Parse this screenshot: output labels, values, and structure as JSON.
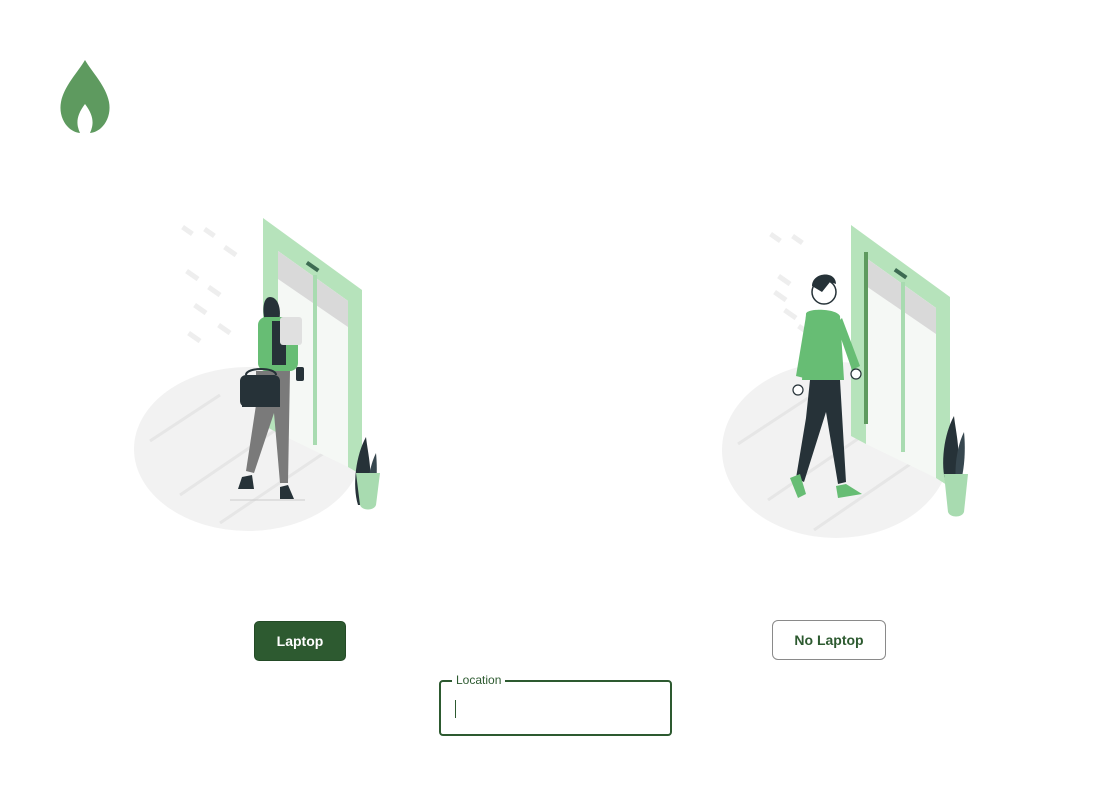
{
  "brand": {
    "logo_icon": "flame-icon",
    "accent_color": "#5e9a5f",
    "primary_dark": "#2d5a30"
  },
  "illustrations": {
    "left_icon": "person-with-laptop-illustration",
    "right_icon": "person-without-laptop-illustration"
  },
  "choices": {
    "laptop_label": "Laptop",
    "no_laptop_label": "No Laptop"
  },
  "location": {
    "label": "Location",
    "value": "",
    "placeholder": ""
  }
}
